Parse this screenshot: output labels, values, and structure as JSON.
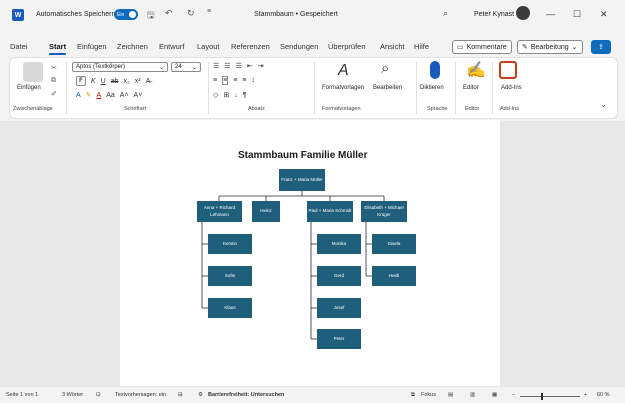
{
  "titlebar": {
    "autosave_label": "Automatisches Speichern",
    "autosave_state": "Ein",
    "doc_title": "Stammbaum • Gespeichert",
    "user_name": "Peter Kynast",
    "minimize": "—",
    "maximize": "☐",
    "close": "✕"
  },
  "tabs": [
    "Datei",
    "Start",
    "Einfügen",
    "Zeichnen",
    "Entwurf",
    "Layout",
    "Referenzen",
    "Sendungen",
    "Überprüfen",
    "Ansicht",
    "Hilfe"
  ],
  "tab_actions": {
    "comments": "Kommentare",
    "editing": "Bearbeitung"
  },
  "ribbon": {
    "paste": "Einfügen",
    "font_name": "Aptos (Textkörper)",
    "font_size": "24",
    "styles": "Formatvorlagen",
    "edit": "Bearbeiten",
    "dictate": "Diktieren",
    "editor": "Editor",
    "addins": "Add-Ins",
    "groups": {
      "clipboard": "Zwischenablage",
      "font": "Schriftart",
      "paragraph": "Absatz",
      "styles": "Formatvorlagen",
      "voice": "Sprache",
      "editor": "Editor",
      "addins": "Add-Ins"
    }
  },
  "document": {
    "title": "Stammbaum Familie Müller",
    "nodes": {
      "root": "Franz + Maria Müller",
      "anna": "Anna + Richard Lehmann",
      "heinz": "Heinz",
      "paul": "Paul + Maria Schmidt",
      "elisabeth": "Elisabeth + Michael Krüger",
      "kerstin": "Kerstin",
      "sofie": "Sofie",
      "klaus": "Klaus",
      "monika": "Monika",
      "gerd": "Gerd",
      "josef": "Josef",
      "peter": "Peter",
      "gisela": "Gisela",
      "heidi": "Heidi"
    }
  },
  "statusbar": {
    "page": "Seite 1 von 1",
    "words": "3 Wörter",
    "predictions": "Textvorhersagen: ein",
    "accessibility": "Barrierefreiheit: Untersuchen",
    "focus": "Fokus",
    "zoom": "60 %"
  },
  "colors": {
    "accent": "#185abd",
    "node": "#1f5f7c"
  }
}
